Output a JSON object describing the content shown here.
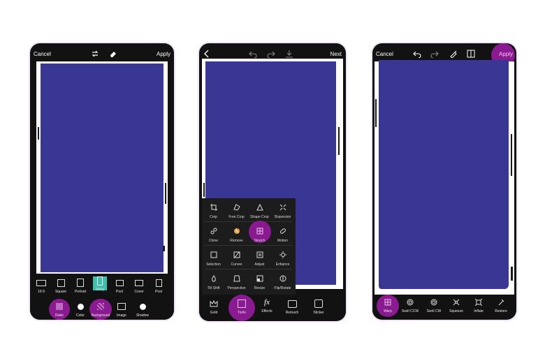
{
  "colors": {
    "canvas": "#3a3794",
    "highlight": "#8a1a8f",
    "phone": "#121212"
  },
  "phone1": {
    "cancel": "Cancel",
    "apply": "Apply",
    "ratios": [
      "16:9",
      "Square",
      "Portrait",
      "Story",
      "Post",
      "Cover",
      "Post"
    ],
    "tabs": [
      "Ratio",
      "Color",
      "Background",
      "Image",
      "Shadow"
    ]
  },
  "phone2": {
    "next": "Next",
    "menu": [
      [
        "Crop",
        "Free Crop",
        "Shape Crop",
        "Dispersion"
      ],
      [
        "Clone",
        "Remove",
        "Stretch",
        "Motion"
      ],
      [
        "Selection",
        "Curves",
        "Adjust",
        "Enhance"
      ],
      [
        "Tilt Shift",
        "Perspective",
        "Resize",
        "Flip/Rotate"
      ]
    ],
    "tabs": [
      "Gold",
      "Tools",
      "Effects",
      "Retouch",
      "Sticker"
    ],
    "fx_glyph": "fx"
  },
  "phone3": {
    "cancel": "Cancel",
    "apply": "Apply",
    "tools": [
      "Warp",
      "Swirl CCW",
      "Swirl CW",
      "Squeeze",
      "Inflate",
      "Restore"
    ]
  }
}
